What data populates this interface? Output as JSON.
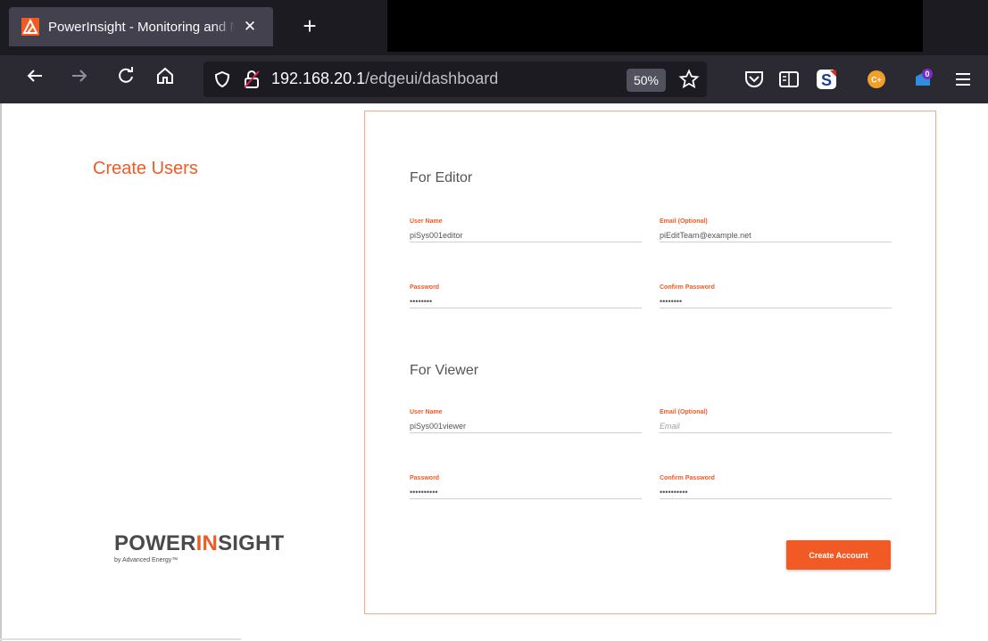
{
  "browser": {
    "tab_title": "PowerInsight - Monitoring and Management",
    "tab_close_glyph": "✕",
    "new_tab_glyph": "+",
    "url_host": "192.168.20.1",
    "url_path": "/edgeui/dashboard",
    "zoom": "50%",
    "icons": {
      "back": "back-arrow-icon",
      "forward": "forward-arrow-icon",
      "reload": "reload-icon",
      "home": "home-icon",
      "shield": "tracking-protection-shield-icon",
      "lock": "insecure-lock-icon",
      "star": "bookmark-star-icon",
      "pocket": "pocket-icon",
      "reader": "reader-view-icon",
      "extension_s": "extension-s-icon",
      "extension_orange": "extension-orange-icon",
      "extension_badge": "extension-badge-icon",
      "menu": "hamburger-menu-icon"
    },
    "extension_badge_count": "0",
    "extension_orange_label": "C+"
  },
  "colors": {
    "accent": "#f15a24",
    "card_border": "#f5a98c",
    "tab_bg": "#42414d",
    "toolbar_bg": "#2b2a33"
  },
  "page": {
    "heading": "Create Users",
    "editor_section": {
      "title": "For Editor",
      "username": {
        "label": "User Name",
        "value": "piSys001editor"
      },
      "email": {
        "label": "Email (Optional)",
        "value": "piEditTeam@example.net",
        "placeholder": "Email"
      },
      "password": {
        "label": "Password",
        "value": "••••••••"
      },
      "confirm_password": {
        "label": "Confirm Password",
        "value": "••••••••"
      }
    },
    "viewer_section": {
      "title": "For Viewer",
      "username": {
        "label": "User Name",
        "value": "piSys001viewer"
      },
      "email": {
        "label": "Email (Optional)",
        "value": "",
        "placeholder": "Email"
      },
      "password": {
        "label": "Password",
        "value": "••••••••••"
      },
      "confirm_password": {
        "label": "Confirm Password",
        "value": "••••••••••"
      }
    },
    "create_button": "Create Account",
    "logo": {
      "power": "POWER",
      "in": "IN",
      "sight": "SIGHT",
      "subtitle": "by Advanced Energy™"
    }
  }
}
